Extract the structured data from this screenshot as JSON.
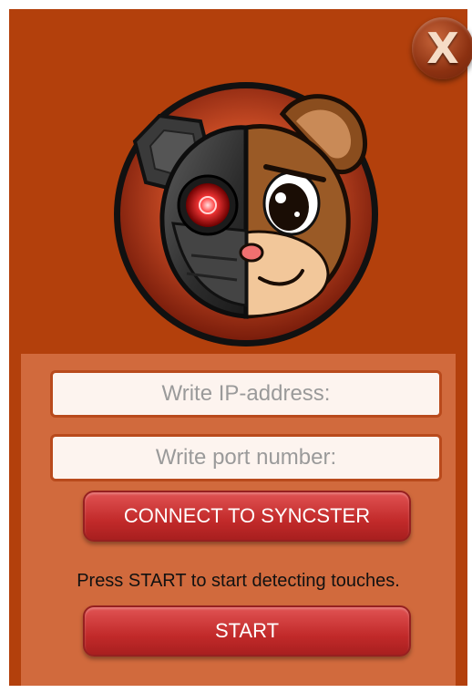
{
  "close_button": {
    "label": "X"
  },
  "form": {
    "ip_placeholder": "Write IP-address:",
    "port_placeholder": "Write port number:",
    "connect_label": "CONNECT TO SYNCSTER",
    "info_text": "Press START to start detecting touches.",
    "start_label": "START"
  },
  "colors": {
    "background": "#b3400c",
    "panel": "#d16a3d",
    "button": "#c22a2a"
  }
}
